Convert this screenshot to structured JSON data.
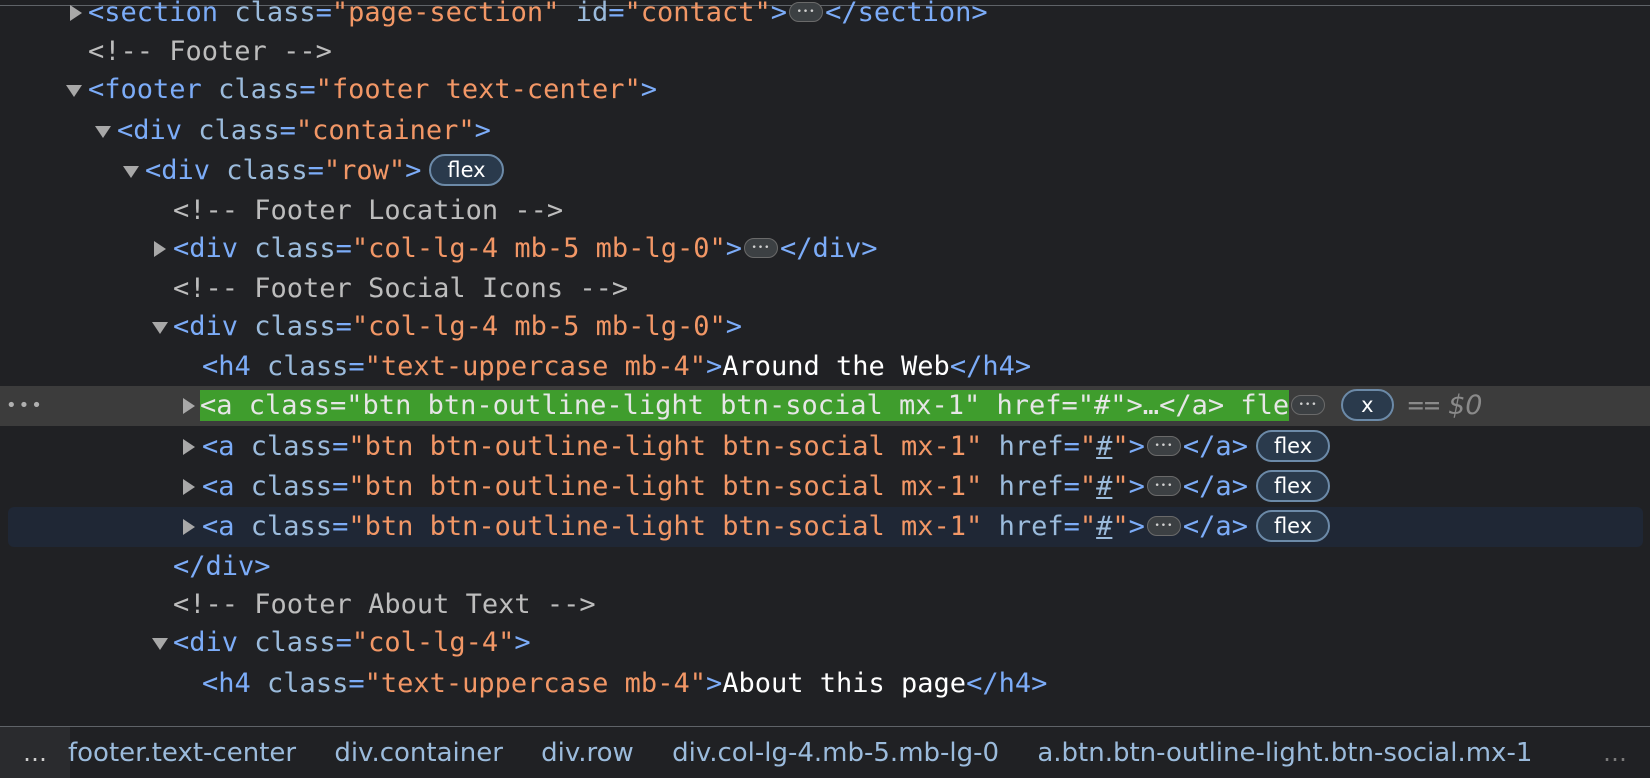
{
  "nodes": {
    "section_contact": {
      "open": "<section",
      "attr1_name": "class",
      "attr1_value": "\"page-section\"",
      "attr2_name": "id",
      "attr2_value": "\"contact\"",
      "gt": ">",
      "close": "</section>"
    },
    "comment_footer": "<!-- Footer -->",
    "footer": {
      "open": "<footer",
      "attr_name": "class",
      "attr_value": "\"footer text-center\"",
      "gt": ">"
    },
    "container": {
      "open": "<div",
      "attr_name": "class",
      "attr_value": "\"container\"",
      "gt": ">"
    },
    "row_div": {
      "open": "<div",
      "attr_name": "class",
      "attr_value": "\"row\"",
      "gt": ">",
      "badge": "flex"
    },
    "comment_location": "<!-- Footer Location -->",
    "col_location": {
      "open": "<div",
      "attr_name": "class",
      "attr_value": "\"col-lg-4 mb-5 mb-lg-0\"",
      "gt": ">",
      "close": "</div>"
    },
    "comment_social": "<!-- Footer Social Icons -->",
    "col_social": {
      "open": "<div",
      "attr_name": "class",
      "attr_value": "\"col-lg-4 mb-5 mb-lg-0\"",
      "gt": ">"
    },
    "h4_web": {
      "open": "<h4",
      "attr_name": "class",
      "attr_value": "\"text-uppercase mb-4\"",
      "gt": ">",
      "text": "Around the Web",
      "close": "</h4>"
    },
    "link_selected": {
      "text": "<a class=\"btn btn-outline-light btn-social mx-1\" href=\"#\">…</a> fle",
      "badge": "x",
      "eq": "==",
      "dollar": "$0"
    },
    "link": {
      "open": "<a",
      "attr1_name": "class",
      "attr1_value": "\"btn btn-outline-light btn-social mx-1\"",
      "attr2_name": "href",
      "q": "\"",
      "hash": "#",
      "gt": ">",
      "close": "</a>",
      "badge": "flex"
    },
    "div_close": "</div>",
    "comment_about": "<!-- Footer About Text -->",
    "col_about": {
      "open": "<div",
      "attr_name": "class",
      "attr_value": "\"col-lg-4\"",
      "gt": ">"
    },
    "h4_about": {
      "open": "<h4",
      "attr_name": "class",
      "attr_value": "\"text-uppercase mb-4\"",
      "gt": ">",
      "text": "About this page",
      "close": "</h4>"
    }
  },
  "breadcrumbs": {
    "more_left": "…",
    "items": [
      "footer.text-center",
      "div.container",
      "div.row",
      "div.col-lg-4.mb-5.mb-lg-0",
      "a.btn.btn-outline-light.btn-social.mx-1"
    ],
    "more_right": "…"
  },
  "colors": {
    "tag": "#7cacf8",
    "attr_name": "#9bbbdc",
    "attr_value": "#f29766",
    "selection_highlight": "#3f9d2d",
    "background": "#202124"
  }
}
